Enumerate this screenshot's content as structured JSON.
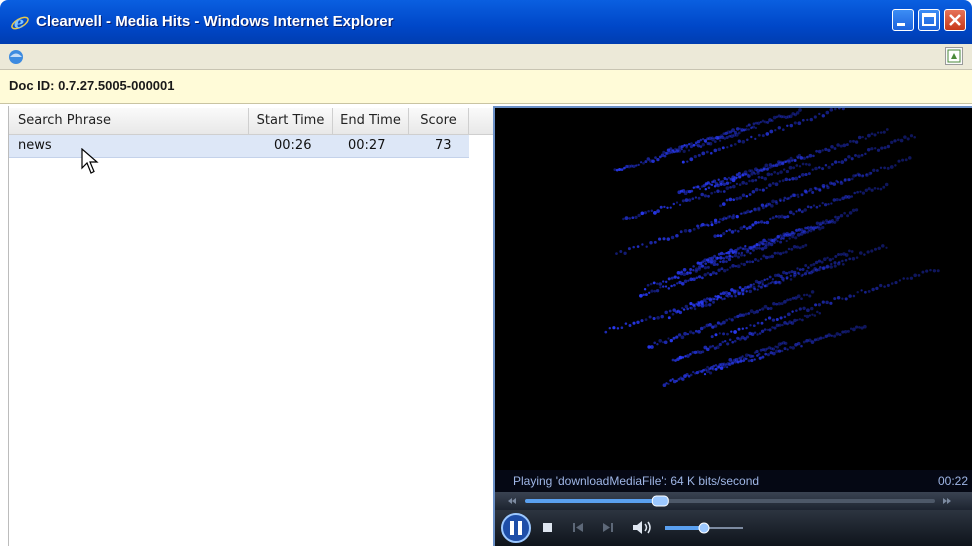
{
  "window": {
    "title": "Clearwell - Media Hits - Windows Internet Explorer",
    "buttons": [
      "minimize-icon",
      "maximize-icon",
      "close-icon"
    ]
  },
  "toolbar": {
    "left_icon": "ie-page-icon",
    "right_icon": "export-icon"
  },
  "doc": {
    "label": "Doc ID: 0.7.27.5005-000001"
  },
  "table": {
    "headers": [
      "Search Phrase",
      "Start Time",
      "End Time",
      "Score"
    ],
    "rows": [
      {
        "phrase": "news",
        "start": "00:26",
        "end": "00:27",
        "score": "73"
      }
    ]
  },
  "player": {
    "status": "Playing 'downloadMediaFile': 64 K bits/second",
    "time": "00:22",
    "seek_progress": 0.33,
    "volume": 0.5,
    "controls": [
      "pause-icon",
      "stop-icon",
      "previous-icon",
      "next-icon",
      "volume-icon"
    ]
  },
  "colors": {
    "titlebar": "#0047c8",
    "docbar": "#fffbd8",
    "selected_row": "#dde7f7",
    "player_bg": "#000000",
    "viz_dots": "#2a3cff"
  }
}
